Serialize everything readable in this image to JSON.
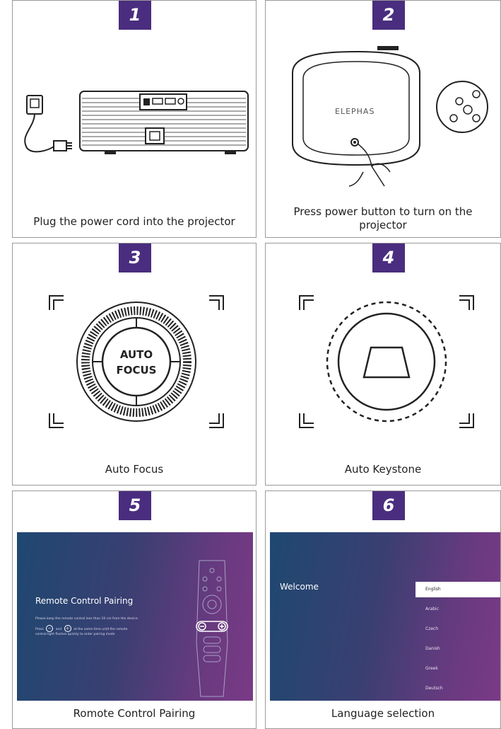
{
  "steps": [
    {
      "number": "1",
      "caption": "Plug the power cord into the projector"
    },
    {
      "number": "2",
      "caption_line1": "Press power button to turn on the",
      "caption_line2": "projector",
      "brand": "ELEPHAS"
    },
    {
      "number": "3",
      "caption": "Auto Focus",
      "lens_line1": "AUTO",
      "lens_line2": "FOCUS"
    },
    {
      "number": "4",
      "caption": "Auto Keystone"
    },
    {
      "number": "5",
      "caption": "Romote Control Pairing",
      "screen_title": "Remote Control Pairing",
      "screen_text_line1": "Please keep the remote control less than 10 cm from the device.",
      "screen_text_press": "Press",
      "screen_text_and": "and",
      "screen_text_rest": "at the same time until the remote",
      "screen_text_line3": "control light flashes quickly to enter pairing mode"
    },
    {
      "number": "6",
      "caption": "Language selection",
      "screen_title": "Welcome",
      "languages": [
        "English",
        "Arabic",
        "Czech",
        "Danish",
        "Greek",
        "Deutsch"
      ]
    }
  ],
  "colors": {
    "badge": "#4a2d7f",
    "border": "#9a9a9a"
  }
}
